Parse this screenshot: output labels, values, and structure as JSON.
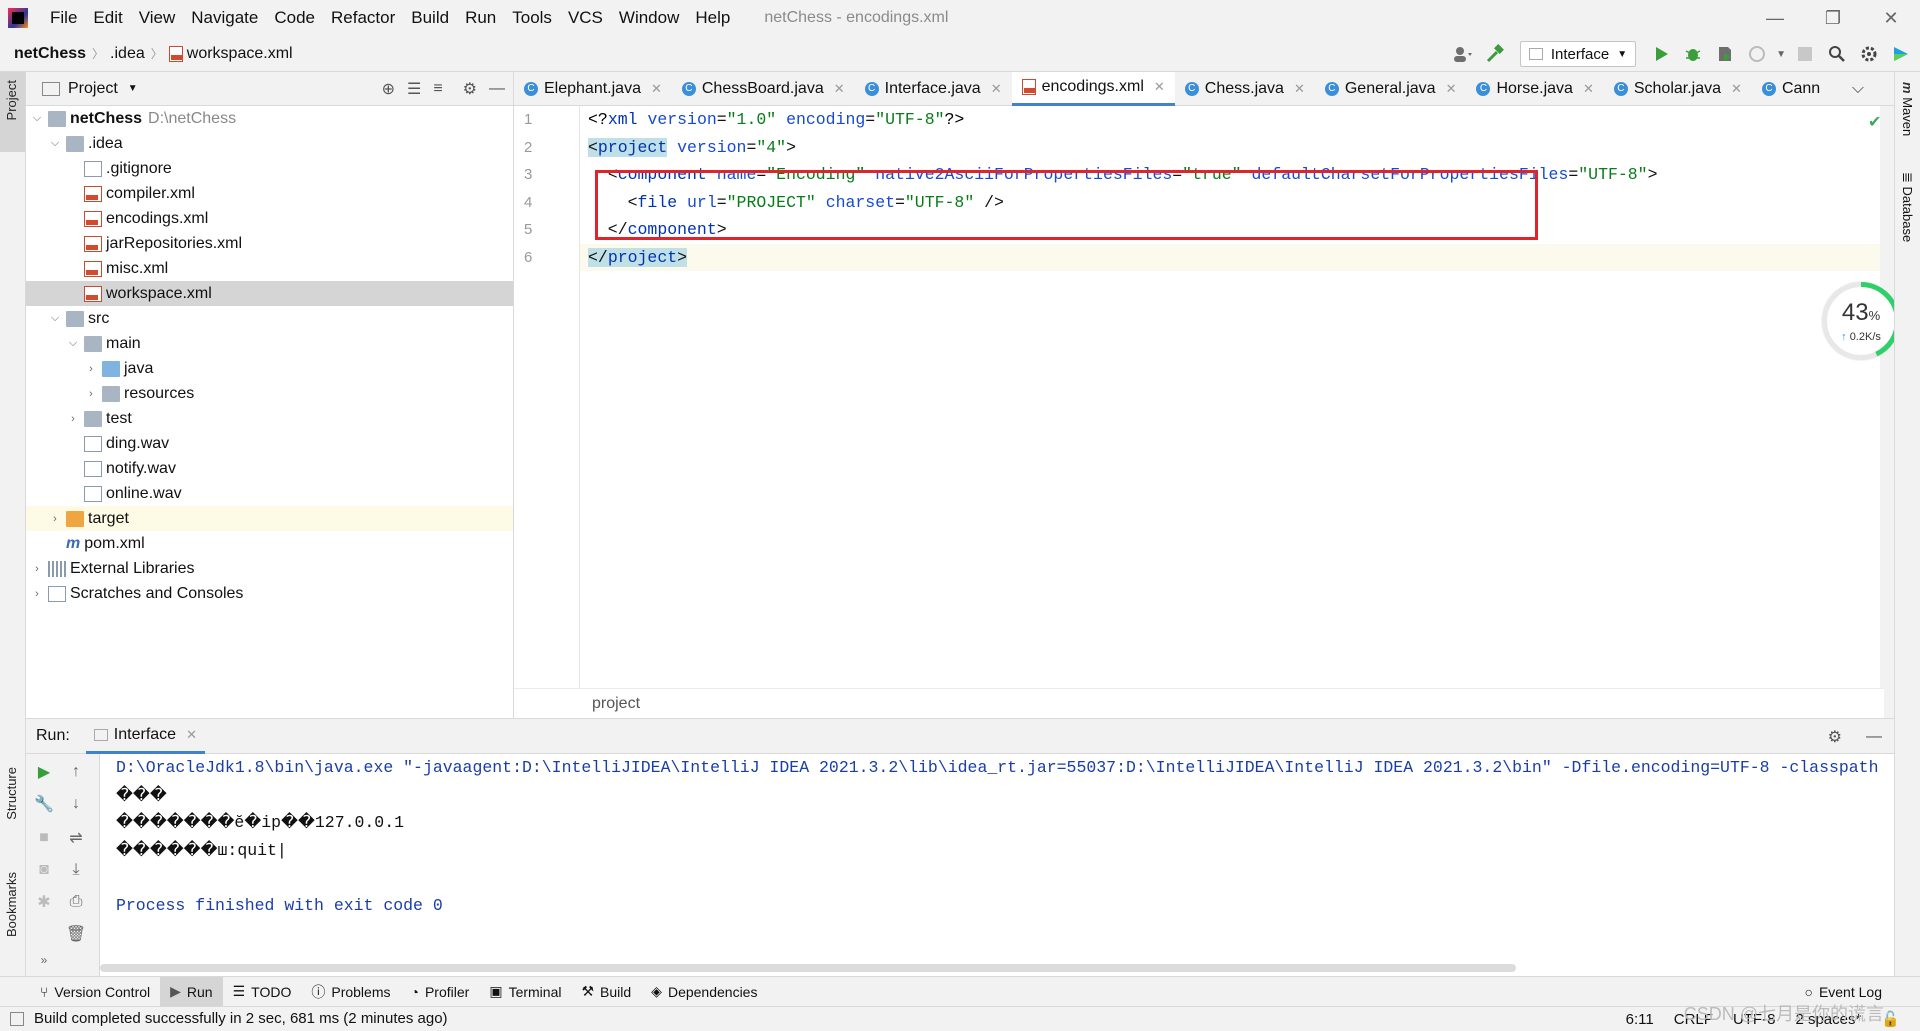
{
  "menubar": {
    "items": [
      "File",
      "Edit",
      "View",
      "Navigate",
      "Code",
      "Refactor",
      "Build",
      "Run",
      "Tools",
      "VCS",
      "Window",
      "Help"
    ],
    "window_title": "netChess - encodings.xml"
  },
  "navbar": {
    "crumbs": [
      "netChess",
      ".idea",
      "workspace.xml"
    ],
    "run_config": "Interface"
  },
  "project_panel": {
    "title": "Project",
    "tree": [
      {
        "label": "netChess",
        "extra": "D:\\netChess"
      },
      {
        "label": ".idea"
      },
      {
        "label": ".gitignore"
      },
      {
        "label": "compiler.xml"
      },
      {
        "label": "encodings.xml"
      },
      {
        "label": "jarRepositories.xml"
      },
      {
        "label": "misc.xml"
      },
      {
        "label": "workspace.xml"
      },
      {
        "label": "src"
      },
      {
        "label": "main"
      },
      {
        "label": "java"
      },
      {
        "label": "resources"
      },
      {
        "label": "test"
      },
      {
        "label": "ding.wav"
      },
      {
        "label": "notify.wav"
      },
      {
        "label": "online.wav"
      },
      {
        "label": "target"
      },
      {
        "label": "pom.xml"
      },
      {
        "label": "External Libraries"
      },
      {
        "label": "Scratches and Consoles"
      }
    ]
  },
  "left_strip": {
    "project": "Project",
    "structure": "Structure",
    "bookmarks": "Bookmarks"
  },
  "right_strip": {
    "maven": "Maven",
    "database": "Database"
  },
  "tabs": [
    "Elephant.java",
    "ChessBoard.java",
    "Interface.java",
    "encodings.xml",
    "Chess.java",
    "General.java",
    "Horse.java",
    "Scholar.java",
    "Cann"
  ],
  "editor": {
    "line_numbers": [
      "1",
      "2",
      "3",
      "4",
      "5",
      "6"
    ],
    "lines": [
      {
        "tag": "xml",
        "a1": "version",
        "v1": "\"1.0\"",
        "a2": "encoding",
        "v2": "\"UTF-8\""
      },
      {
        "tag": "project",
        "a1": "version",
        "v1": "\"4\""
      },
      {
        "tag": "component",
        "a1": "name",
        "v1": "\"Encoding\"",
        "a2": "native2AsciiForPropertiesFiles",
        "v2": "\"true\"",
        "a3": "defaultCharsetForPropertiesFiles",
        "v3": "\"UTF-8\""
      },
      {
        "tag": "file",
        "a1": "url",
        "v1": "\"PROJECT\"",
        "a2": "charset",
        "v2": "\"UTF-8\""
      },
      {
        "tag": "component"
      },
      {
        "tag": "project"
      }
    ],
    "breadcrumb": "project"
  },
  "speed_widget": {
    "percent": "43",
    "unit": "%",
    "rate": "0.2K/s",
    "fraction": 0.43
  },
  "run": {
    "label": "Run:",
    "tab": "Interface",
    "console": [
      "D:\\OracleJdk1.8\\bin\\java.exe \"-javaagent:D:\\IntelliJIDEA\\IntelliJ IDEA 2021.3.2\\lib\\idea_rt.jar=55037:D:\\IntelliJIDEA\\IntelliJ IDEA 2021.3.2\\bin\" -Dfile.encoding=UTF-8 -classpath",
      "���",
      "�������ĕ�ip��127.0.0.1",
      "������ш:quit|",
      "",
      "Process finished with exit code 0"
    ]
  },
  "tool_windows": [
    "Version Control",
    "Run",
    "TODO",
    "Problems",
    "Profiler",
    "Terminal",
    "Build",
    "Dependencies"
  ],
  "event_log": "Event Log",
  "status": {
    "message": "Build completed successfully in 2 sec, 681 ms (2 minutes ago)",
    "position": "6:11",
    "line_sep": "CRLF",
    "encoding": "UTF-8",
    "indent": "2 spaces*"
  },
  "watermark": "CSDN @七月是你的谎言..",
  "colors": {
    "accent": "#4083c9",
    "highlight_box": "#e0242b",
    "xml_tag": "#0033b3",
    "xml_value": "#067d17"
  }
}
